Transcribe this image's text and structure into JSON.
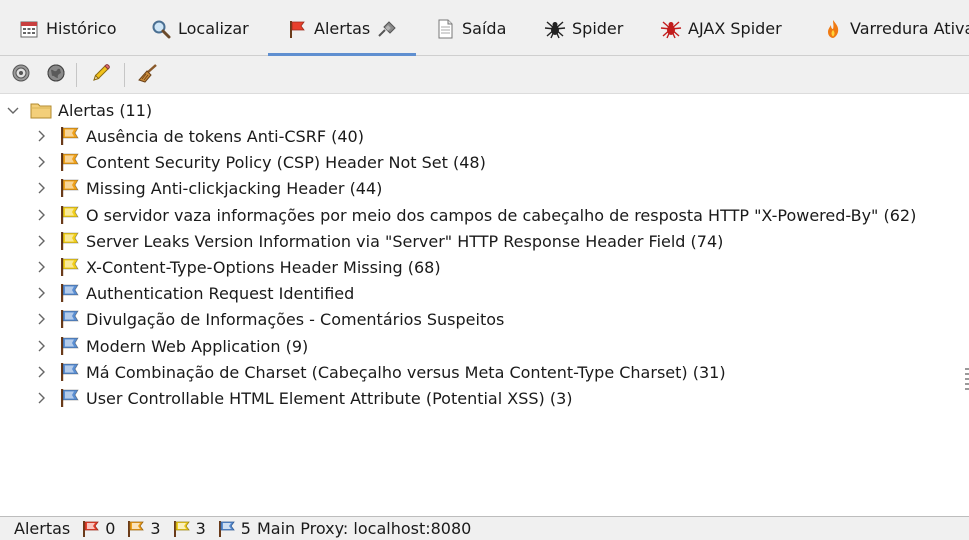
{
  "tabs": [
    {
      "label": "Histórico",
      "icon": "calendar-icon"
    },
    {
      "label": "Localizar",
      "icon": "magnifier-icon"
    },
    {
      "label": "Alertas",
      "icon": "red-flag-icon",
      "active": true
    },
    {
      "label": "Saída",
      "icon": "document-icon"
    },
    {
      "label": "Spider",
      "icon": "spider-icon"
    },
    {
      "label": "AJAX Spider",
      "icon": "red-spider-icon"
    },
    {
      "label": "Varredura Ativa",
      "icon": "flame-icon"
    }
  ],
  "toolbar": {
    "buttons": [
      "target-icon",
      "globe-icon",
      "pencil-icon",
      "broom-icon"
    ]
  },
  "tree": {
    "root_label": "Alertas (11)",
    "items": [
      {
        "label": "Ausência de tokens Anti-CSRF (40)",
        "risk": "medium"
      },
      {
        "label": "Content Security Policy (CSP) Header Not Set (48)",
        "risk": "medium"
      },
      {
        "label": "Missing Anti-clickjacking Header (44)",
        "risk": "medium"
      },
      {
        "label": "O servidor vaza informações por meio dos campos de cabeçalho de resposta HTTP \"X-Powered-By\" (62)",
        "risk": "low"
      },
      {
        "label": "Server Leaks Version Information via \"Server\" HTTP Response Header Field (74)",
        "risk": "low"
      },
      {
        "label": "X-Content-Type-Options Header Missing (68)",
        "risk": "low"
      },
      {
        "label": "Authentication Request Identified",
        "risk": "info"
      },
      {
        "label": "Divulgação de Informações - Comentários Suspeitos",
        "risk": "info"
      },
      {
        "label": "Modern Web Application (9)",
        "risk": "info"
      },
      {
        "label": "Má Combinação de Charset (Cabeçalho versus Meta Content-Type Charset) (31)",
        "risk": "info"
      },
      {
        "label": "User Controllable HTML Element Attribute (Potential XSS) (3)",
        "risk": "info"
      }
    ]
  },
  "statusbar": {
    "label": "Alertas",
    "high_count": "0",
    "medium_count": "3",
    "low_count": "3",
    "info_count": "5",
    "proxy_text": "Main Proxy: localhost:8080"
  },
  "colors": {
    "high": "#e8402c",
    "medium": "#f0a21c",
    "low": "#f2cf1d",
    "info": "#5b8fd3",
    "tab_underline": "#5f8fd0"
  }
}
